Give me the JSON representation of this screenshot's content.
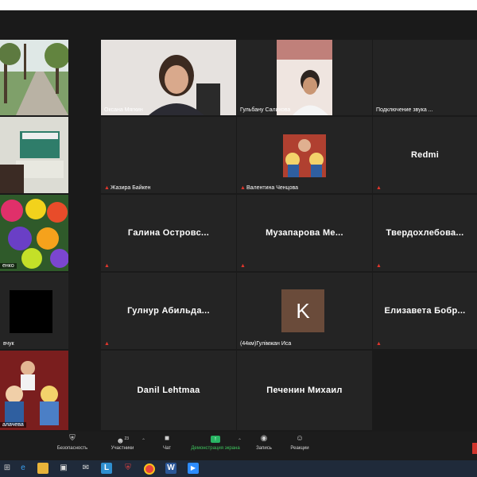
{
  "participants": {
    "oksana": "Оксана Мягкин",
    "gulbanu": "Гульбану Салихова",
    "audio": "Подключение звука ...",
    "zhazira": "Жазира Байкен",
    "valentina": "Валентина Ченцова",
    "redmi": "Redmi",
    "flowers_partial": "енко",
    "galina": "Галина  Островс...",
    "muzaparova": "Музапарова  Ме...",
    "tverdokhlebova": "Твердохлебова...",
    "black_partial": "вчук",
    "gulnur": "Гулнур  Абильда...",
    "gulmzhan": "(44км)Гулімжан Иса",
    "gulmzhan_initial": "K",
    "elizaveta": "Елизавета  Бобр...",
    "dolls_partial": "алачева",
    "danil": "Danil Lehtmaa",
    "pechenin": "Печенин Михаил"
  },
  "toolbar": {
    "security": "Безопасность",
    "participants": "Участники",
    "participants_count": "23",
    "chat": "Чат",
    "share": "Демонстрация экрана",
    "record": "Запись",
    "reactions": "Реакции"
  },
  "colors": {
    "accent_green": "#3ec45d",
    "mic_muted": "#e0362c"
  }
}
